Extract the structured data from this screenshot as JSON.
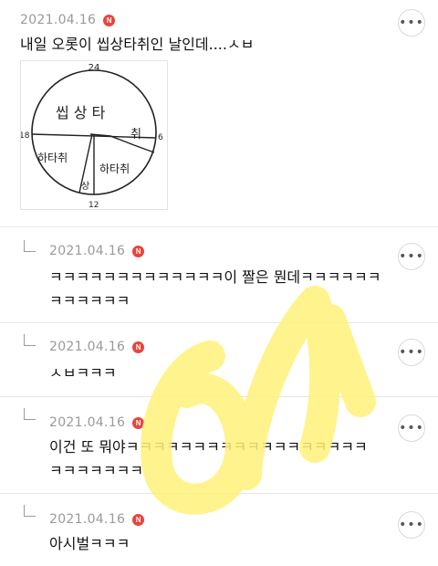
{
  "post": {
    "date": "2021.04.16",
    "badge": "N",
    "text": "내일 오롯이 씹상타취인 날인데....ㅅㅂ",
    "more_label": "•••",
    "drawing": {
      "top_label": "24",
      "left_label": "18",
      "right_label": "6",
      "bottom_label": "12",
      "seg_top": "씹 상 타",
      "seg_right": "취",
      "seg_left": "하타취",
      "seg_mid": "상",
      "seg_right_bottom": "하타취"
    }
  },
  "replies": [
    {
      "date": "2021.04.16",
      "badge": "N",
      "more_label": "•••",
      "line1": "ㅋㅋㅋㅋㅋㅋㅋㅋㅋㅋㅋㅋㅋ이 짤은 뭔데ㅋㅋㅋㅋㅋㅋ",
      "line2": "ㅋㅋㅋㅋㅋㅋ"
    },
    {
      "date": "2021.04.16",
      "badge": "N",
      "more_label": "•••",
      "line1": "ㅅㅂㅋㅋㅋ"
    },
    {
      "date": "2021.04.16",
      "badge": "N",
      "more_label": "•••",
      "line1": "이건 또 뭐야ㅋㅋㅋㅋㅋㅋㅋㅋㅋㅋㅋㅋㅋㅋㅋㅋㅋㅋ",
      "line2": "ㅋㅋㅋㅋㅋㅋㅋ"
    },
    {
      "date": "2021.04.16",
      "badge": "N",
      "more_label": "•••",
      "line1": "아시벌ㅋㅋㅋ"
    }
  ],
  "colors": {
    "badge": "#e8453c",
    "watermark": "#fff17a",
    "meta": "#9a9a9a"
  }
}
